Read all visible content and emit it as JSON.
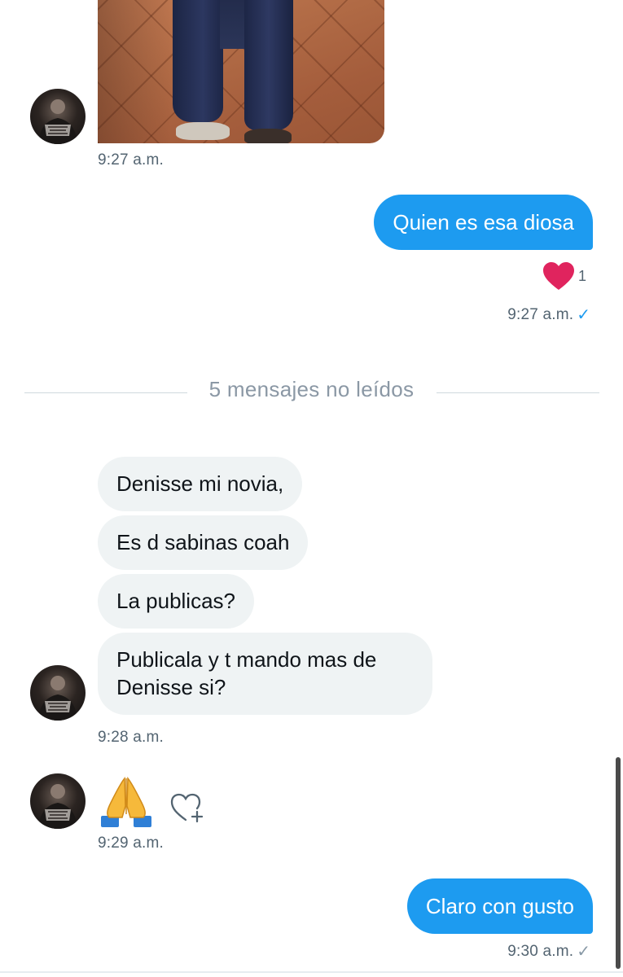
{
  "messages": {
    "photo_time": "9:27 a.m.",
    "out1": {
      "text": "Quien es esa diosa",
      "reaction_count": "1",
      "time": "9:27 a.m.",
      "status_icon": "✓"
    },
    "unread_divider": "5 mensajes no leídos",
    "in_group": [
      "Denisse mi novia,",
      "Es d sabinas coah",
      "La publicas?",
      "Publicala y t mando mas de Denisse si?"
    ],
    "in_group_time": "9:28 a.m.",
    "emoji_message": "🙏",
    "emoji_time": "9:29 a.m.",
    "out2": {
      "text": "Claro con gusto",
      "time": "9:30 a.m.",
      "status_icon": "✓"
    }
  },
  "colors": {
    "accent_blue": "#1d9bf0",
    "incoming_bubble": "#eff3f4",
    "heart_red": "#e0245e"
  },
  "icons": {
    "reaction": "heart-icon",
    "add_reaction": "heart-plus-icon",
    "read_receipt": "check-icon"
  }
}
